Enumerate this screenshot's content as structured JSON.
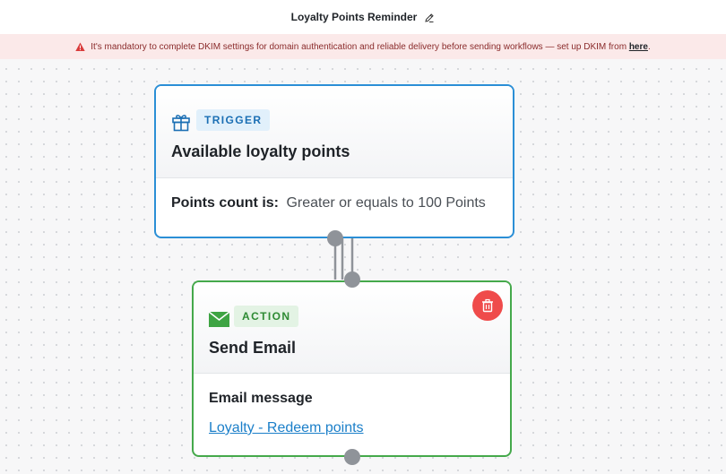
{
  "header": {
    "title": "Loyalty Points Reminder"
  },
  "banner": {
    "message": "It's mandatory to complete DKIM settings for domain authentication and reliable delivery before sending workflows — set up DKIM from",
    "link": "here",
    "suffix": "."
  },
  "trigger": {
    "tag": "TRIGGER",
    "title": "Available loyalty points",
    "condition_label": "Points count is:",
    "condition_value": "Greater or equals to 100 Points",
    "icon": "gift-icon"
  },
  "action": {
    "tag": "ACTION",
    "title": "Send Email",
    "message_label": "Email message",
    "message_link": "Loyalty - Redeem points",
    "icon": "envelope-icon"
  },
  "colors": {
    "trigger_border": "#2b8fd6",
    "action_border": "#45a94b",
    "delete": "#ef4b4b",
    "banner_bg": "#fbe9e9",
    "link": "#1b7fc9"
  }
}
